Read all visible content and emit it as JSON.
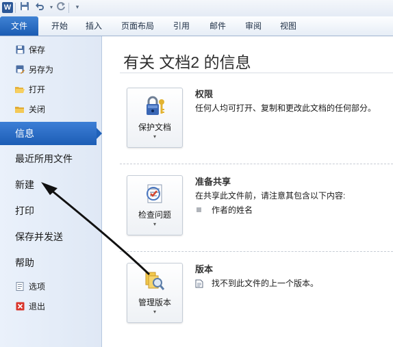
{
  "app": {
    "logo_letter": "W"
  },
  "quick_access": {
    "icons": [
      "save-icon",
      "undo-icon",
      "redo-icon",
      "customize-icon"
    ]
  },
  "ribbon_tabs": [
    {
      "label": "文件",
      "active": true
    },
    {
      "label": "开始"
    },
    {
      "label": "插入"
    },
    {
      "label": "页面布局"
    },
    {
      "label": "引用"
    },
    {
      "label": "邮件"
    },
    {
      "label": "审阅"
    },
    {
      "label": "视图"
    }
  ],
  "sidebar": {
    "items": [
      {
        "label": "保存",
        "icon": "save-icon",
        "kind": "small"
      },
      {
        "label": "另存为",
        "icon": "save-as-icon",
        "kind": "small"
      },
      {
        "label": "打开",
        "icon": "open-folder-icon",
        "kind": "small"
      },
      {
        "label": "关闭",
        "icon": "close-folder-icon",
        "kind": "small"
      },
      {
        "label": "信息",
        "kind": "big",
        "active": true
      },
      {
        "label": "最近所用文件",
        "kind": "big"
      },
      {
        "label": "新建",
        "kind": "big"
      },
      {
        "label": "打印",
        "kind": "big"
      },
      {
        "label": "保存并发送",
        "kind": "big"
      },
      {
        "label": "帮助",
        "kind": "big"
      },
      {
        "label": "选项",
        "icon": "options-icon",
        "kind": "small"
      },
      {
        "label": "退出",
        "icon": "exit-icon",
        "kind": "small"
      }
    ]
  },
  "main": {
    "title": "有关 文档2 的信息",
    "sections": [
      {
        "button_label": "保护文档",
        "button_icon": "lock-keys-icon",
        "heading": "权限",
        "description": "任何人均可打开、复制和更改此文档的任何部分。"
      },
      {
        "button_label": "检查问题",
        "button_icon": "checklist-icon",
        "heading": "准备共享",
        "description": "在共享此文件前，请注意其包含以下内容:",
        "bullet": "作者的姓名"
      },
      {
        "button_label": "管理版本",
        "button_icon": "document-magnifier-icon",
        "heading": "版本",
        "description": "找不到此文件的上一个版本。"
      }
    ]
  },
  "colors": {
    "file_tab": "#1b5cb3",
    "active_item": "#2a6cc6",
    "annotation_arrow": "#111111"
  }
}
